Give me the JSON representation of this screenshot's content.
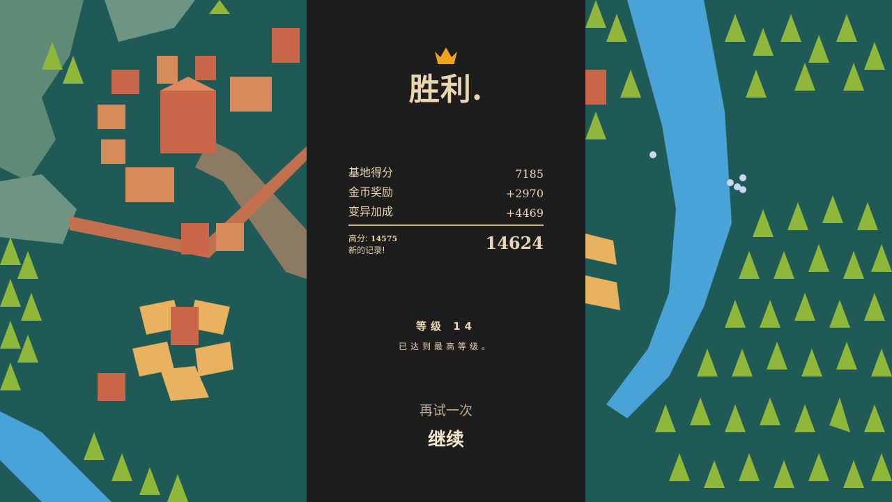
{
  "victory": {
    "title": "胜利.",
    "crown_icon": "crown-icon",
    "accent_color": "#f0a21e"
  },
  "scores": [
    {
      "label": "基地得分",
      "value": "7185"
    },
    {
      "label": "金币奖励",
      "value": "+2970"
    },
    {
      "label": "变异加成",
      "value": "+4469"
    }
  ],
  "highscore": {
    "label": "高分:",
    "value": "14575",
    "new_record": "新的记录!"
  },
  "total": "14624",
  "level": {
    "text": "等级 14",
    "max_text": "已达到最高等级。"
  },
  "actions": {
    "retry": "再试一次",
    "continue": "继续"
  },
  "colors": {
    "panel_bg": "#1d1d1d",
    "text": "#e8d6b4",
    "ground": "#1f5a57",
    "river": "#4aa3d6",
    "tree": "#8fb83a",
    "building": "#c9664a"
  }
}
